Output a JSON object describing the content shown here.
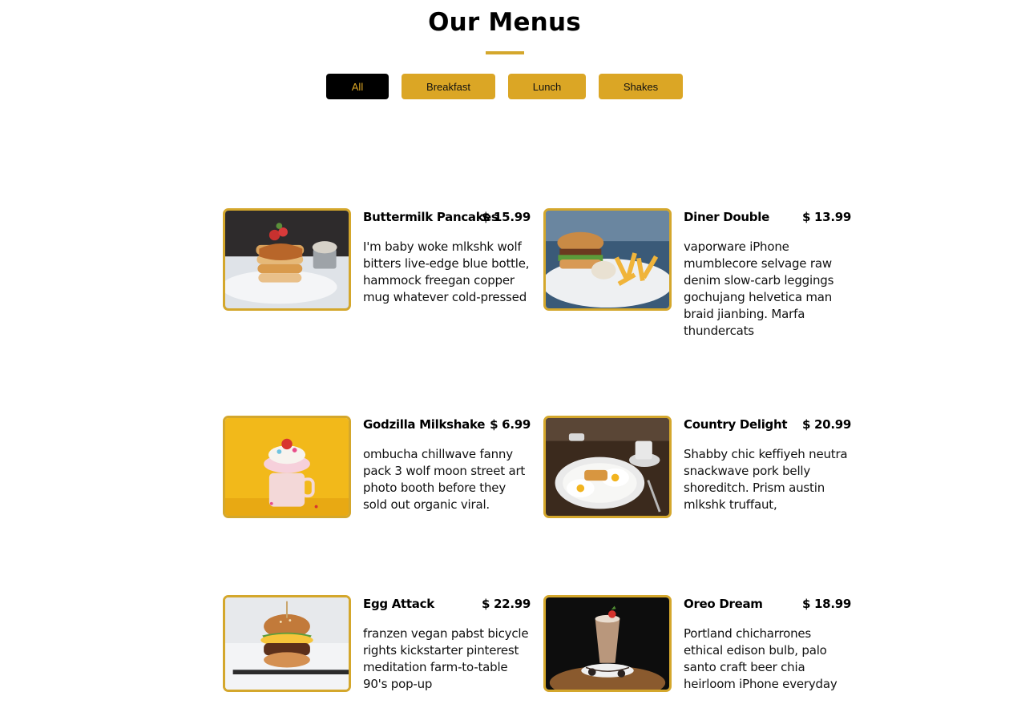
{
  "page": {
    "title": "Our Menus",
    "accent_color": "#d4a72c"
  },
  "filters": [
    {
      "label": "All",
      "active": true
    },
    {
      "label": "Breakfast",
      "active": false
    },
    {
      "label": "Lunch",
      "active": false
    },
    {
      "label": "Shakes",
      "active": false
    }
  ],
  "menu": [
    {
      "name": "Buttermilk Pancakes",
      "price": "$ 15.99",
      "description": "I'm baby woke mlkshk wolf bitters live-edge blue bottle, hammock freegan copper mug whatever cold-pressed",
      "image": "pancakes-photo"
    },
    {
      "name": "Diner Double",
      "price": "$ 13.99",
      "description": "vaporware iPhone mumblecore selvage raw denim slow-carb leggings gochujang helvetica man braid jianbing. Marfa thundercats",
      "image": "burger-fries-photo"
    },
    {
      "name": "Godzilla Milkshake",
      "price": "$ 6.99",
      "description": "ombucha chillwave fanny pack 3 wolf moon street art photo booth before they sold out organic viral.",
      "image": "milkshake-photo"
    },
    {
      "name": "Country Delight",
      "price": "$ 20.99",
      "description": "Shabby chic keffiyeh neutra snackwave pork belly shoreditch. Prism austin mlkshk truffaut,",
      "image": "eggs-breakfast-photo"
    },
    {
      "name": "Egg Attack",
      "price": "$ 22.99",
      "description": "franzen vegan pabst bicycle rights kickstarter pinterest meditation farm-to-table 90's pop-up",
      "image": "egg-burger-photo"
    },
    {
      "name": "Oreo Dream",
      "price": "$ 18.99",
      "description": "Portland chicharrones ethical edison bulb, palo santo craft beer chia heirloom iPhone everyday",
      "image": "oreo-shake-photo"
    }
  ]
}
